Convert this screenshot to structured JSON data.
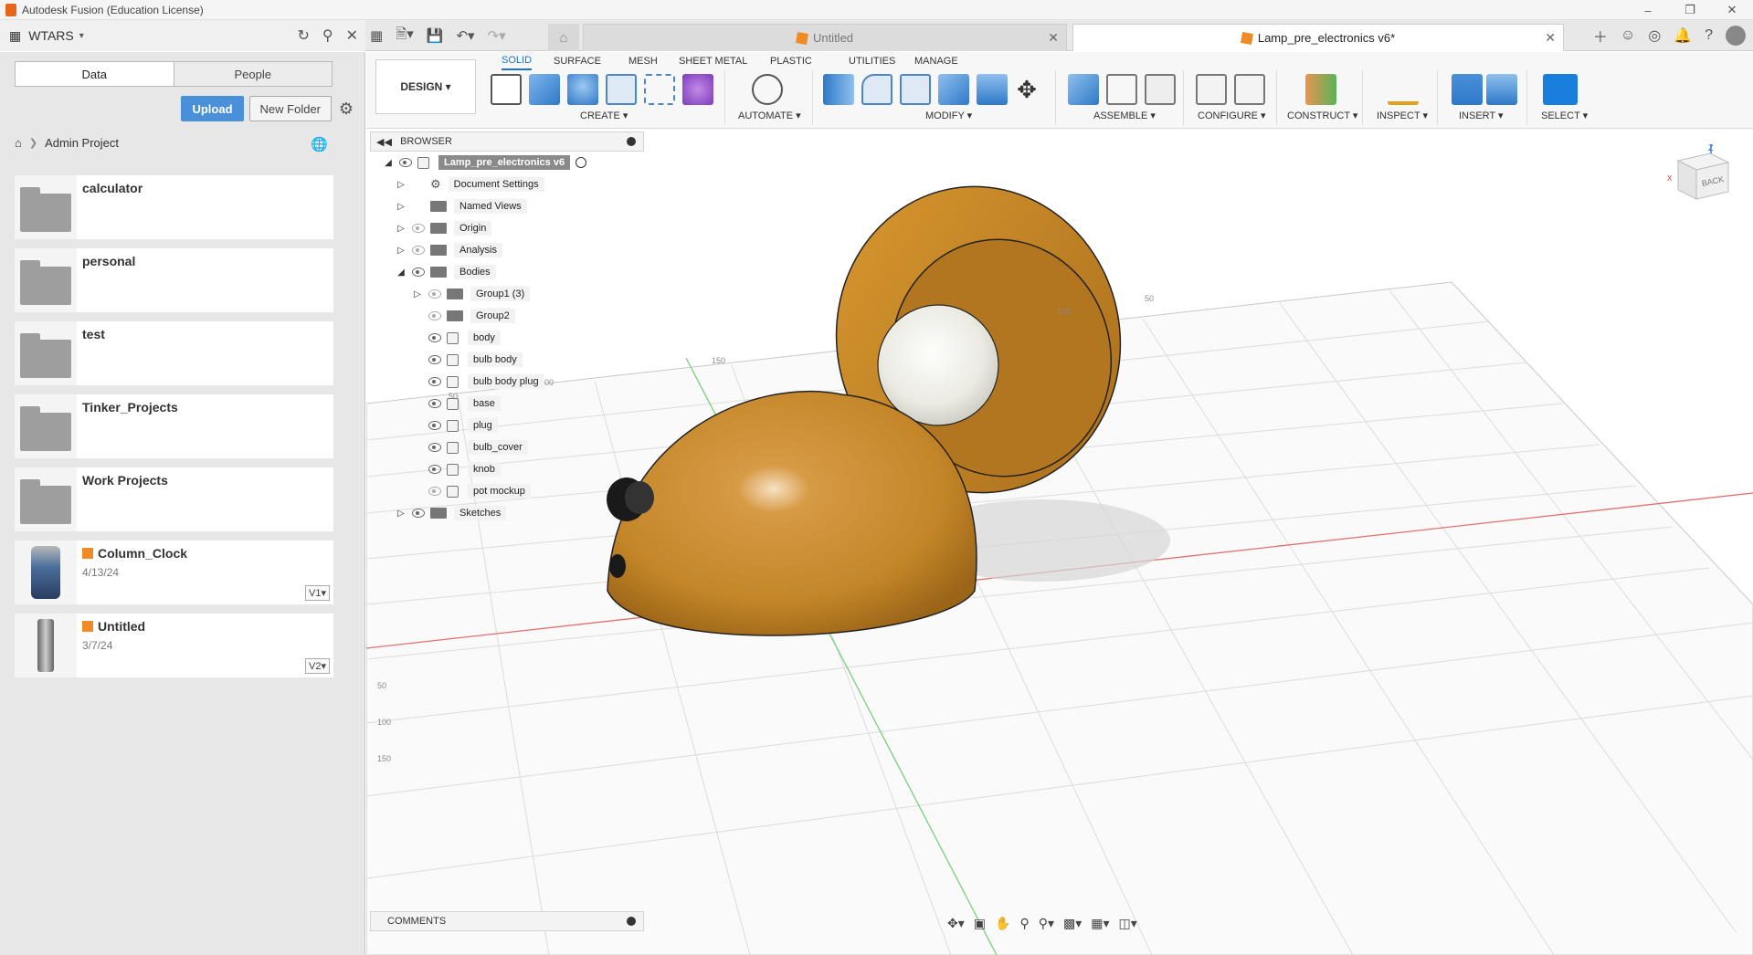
{
  "window": {
    "title": "Autodesk Fusion (Education License)"
  },
  "team": {
    "name": "WTARS"
  },
  "doc_tabs": [
    {
      "label": "Untitled",
      "active": false
    },
    {
      "label": "Lamp_pre_electronics v6*",
      "active": true
    }
  ],
  "data_panel": {
    "tabs": [
      "Data",
      "People"
    ],
    "upload_label": "Upload",
    "new_folder_label": "New Folder",
    "breadcrumb": "Admin Project",
    "items": [
      {
        "name": "calculator",
        "type": "folder"
      },
      {
        "name": "personal",
        "type": "folder"
      },
      {
        "name": "test",
        "type": "folder"
      },
      {
        "name": "Tinker_Projects",
        "type": "folder"
      },
      {
        "name": "Work Projects",
        "type": "folder"
      },
      {
        "name": "Column_Clock",
        "type": "design",
        "date": "4/13/24",
        "version": "V1"
      },
      {
        "name": "Untitled",
        "type": "design",
        "date": "3/7/24",
        "version": "V2"
      }
    ]
  },
  "toolbar": {
    "workspace": "DESIGN",
    "tabs": [
      "SOLID",
      "SURFACE",
      "MESH",
      "SHEET METAL",
      "PLASTIC",
      "UTILITIES",
      "MANAGE"
    ],
    "groups": [
      "CREATE",
      "AUTOMATE",
      "MODIFY",
      "ASSEMBLE",
      "CONFIGURE",
      "CONSTRUCT",
      "INSPECT",
      "INSERT",
      "SELECT"
    ]
  },
  "browser": {
    "title": "BROWSER",
    "root": "Lamp_pre_electronics v6",
    "nodes": [
      {
        "label": "Document Settings"
      },
      {
        "label": "Named Views"
      },
      {
        "label": "Origin"
      },
      {
        "label": "Analysis"
      },
      {
        "label": "Bodies"
      },
      {
        "label": "Group1 (3)"
      },
      {
        "label": "Group2"
      },
      {
        "label": "body"
      },
      {
        "label": "bulb body"
      },
      {
        "label": "bulb body plug"
      },
      {
        "label": "base"
      },
      {
        "label": "plug"
      },
      {
        "label": "bulb_cover"
      },
      {
        "label": "knob"
      },
      {
        "label": "pot mockup"
      },
      {
        "label": "Sketches"
      }
    ]
  },
  "comments": {
    "title": "COMMENTS"
  },
  "viewcube": {
    "face": "BACK",
    "z": "Z",
    "x": "X"
  },
  "grid_labels": [
    "50",
    "100",
    "150",
    "100",
    "50",
    "50",
    "100",
    "150"
  ],
  "colors": {
    "accent": "#1a74d2",
    "body": "#c98b2e",
    "bulb": "#efefe9"
  }
}
